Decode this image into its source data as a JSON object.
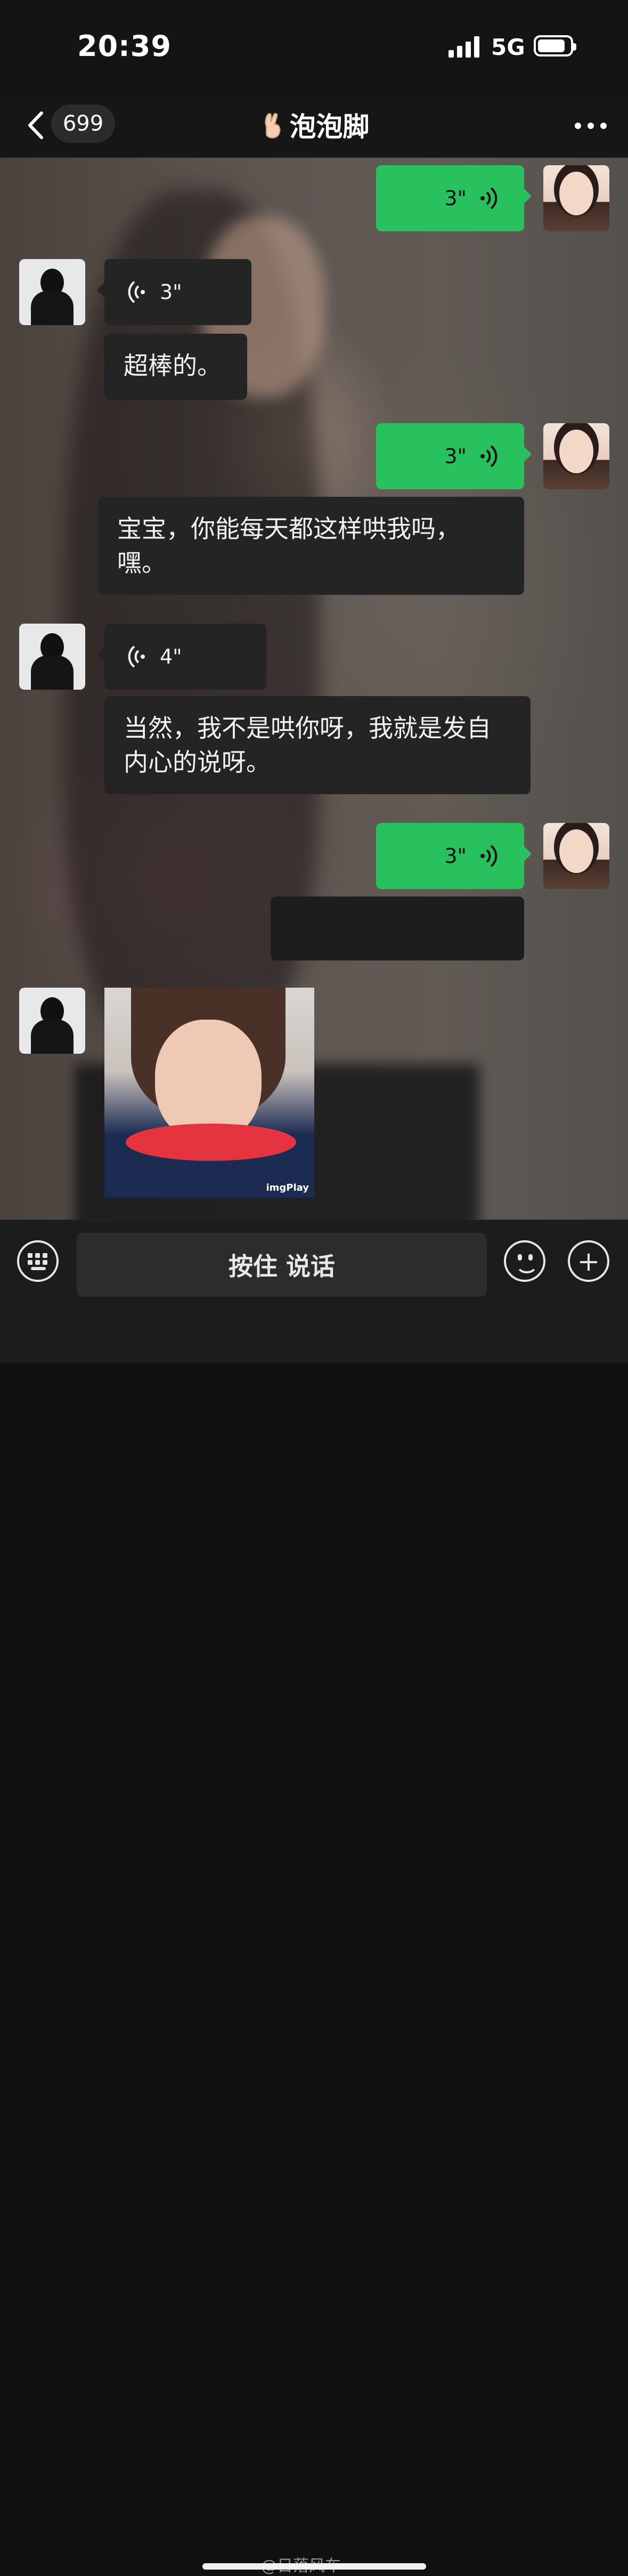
{
  "status": {
    "time": "20:39",
    "network": "5G"
  },
  "nav": {
    "unread_count": "699",
    "chat_title": "泡泡脚",
    "title_emoji": "crossed-fingers-emoji"
  },
  "messages": [
    {
      "id": "m1",
      "side": "out",
      "type": "voice",
      "duration": "3\""
    },
    {
      "id": "m2",
      "side": "in",
      "type": "voice",
      "duration": "3\""
    },
    {
      "id": "m3",
      "side": "in",
      "type": "text",
      "text": "超棒的。"
    },
    {
      "id": "m4",
      "side": "out",
      "type": "voice",
      "duration": "3\""
    },
    {
      "id": "m5",
      "side": "in",
      "type": "text",
      "text": "宝宝，你能每天都这样哄我吗，嘿。"
    },
    {
      "id": "m6",
      "side": "in",
      "type": "voice",
      "duration": "4\""
    },
    {
      "id": "m7",
      "side": "in",
      "type": "text",
      "text": "当然，我不是哄你呀，我就是发自内心的说呀。"
    },
    {
      "id": "m8",
      "side": "out",
      "type": "voice",
      "duration": "3\""
    },
    {
      "id": "m9",
      "side": "in",
      "type": "text",
      "text": ""
    },
    {
      "id": "m10",
      "side": "in",
      "type": "sticker",
      "watermark": "imgPlay"
    }
  ],
  "input": {
    "hold_to_talk_label": "按住 说话"
  },
  "watermark": "@日落风车",
  "colors": {
    "outgoing_bubble": "#29c05e",
    "incoming_bubble": "#242424"
  },
  "icons": [
    "back-chevron-icon",
    "more-icon",
    "voice-wave-icon",
    "keyboard-icon",
    "emoji-icon",
    "plus-icon",
    "weibo-icon"
  ]
}
